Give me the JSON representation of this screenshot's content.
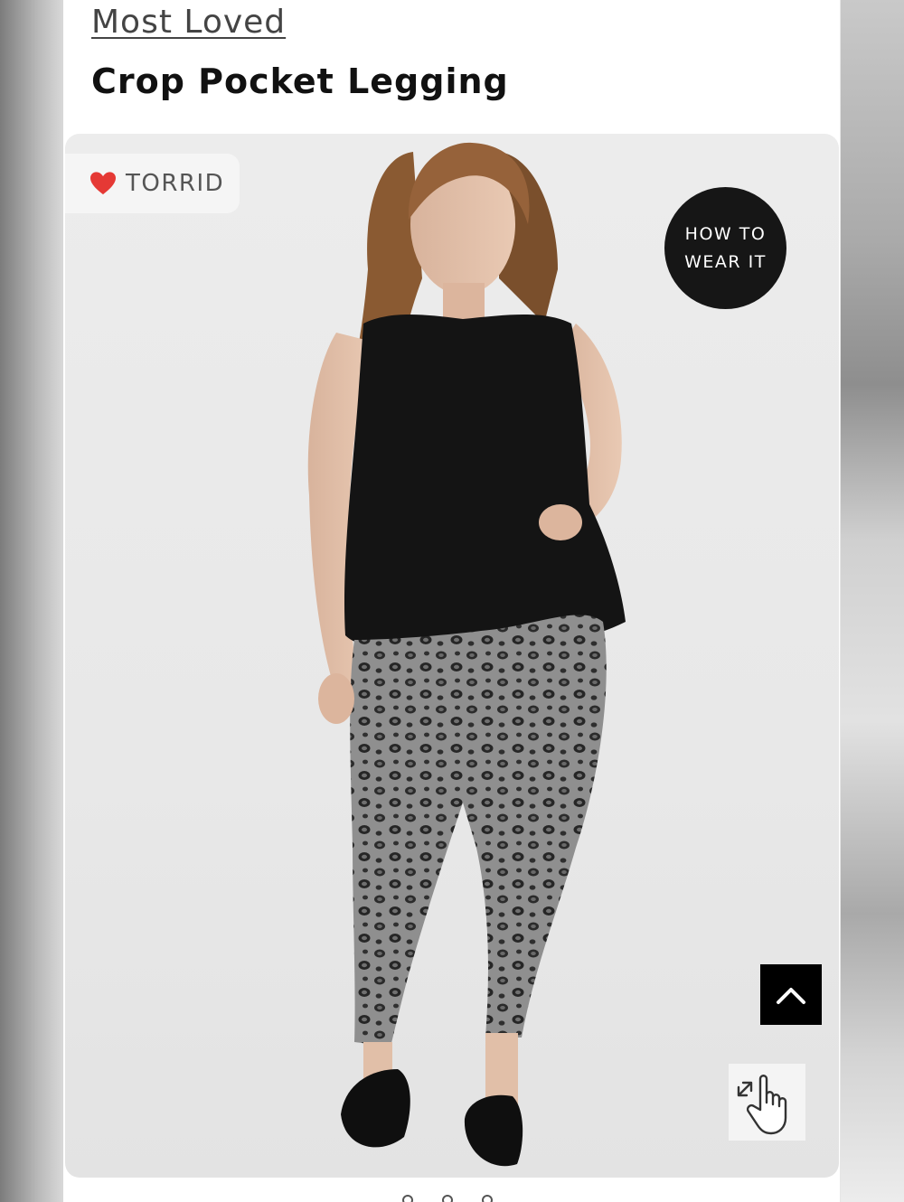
{
  "breadcrumb": "Most Loved",
  "product": {
    "title": "Crop Pocket Legging"
  },
  "badge": {
    "icon": "heart-icon",
    "text": "TORRID",
    "heart_color": "#e53935"
  },
  "how_to_wear": {
    "line1": "HOW TO",
    "line2": "WEAR IT"
  },
  "scroll_top": {
    "icon": "chevron-up-icon"
  },
  "zoom_hint": {
    "icon": "pinch-zoom-hand-icon"
  },
  "colors": {
    "accent": "#161616",
    "background": "#ffffff"
  }
}
